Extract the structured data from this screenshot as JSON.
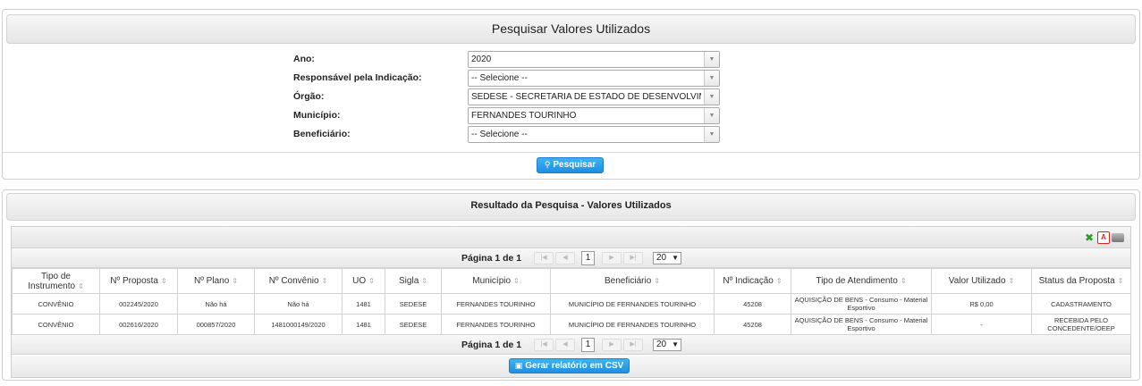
{
  "search": {
    "title": "Pesquisar Valores Utilizados",
    "fields": [
      {
        "label": "Ano:",
        "value": "2020"
      },
      {
        "label": "Responsável pela Indicação:",
        "value": "-- Selecione --"
      },
      {
        "label": "Órgão:",
        "value": "SEDESE - SECRETARIA DE ESTADO DE DESENVOLVIMENTO SOCIAL"
      },
      {
        "label": "Município:",
        "value": "FERNANDES TOURINHO"
      },
      {
        "label": "Beneficiário:",
        "value": "-- Selecione --"
      }
    ],
    "button_label": "Pesquisar"
  },
  "results": {
    "title": "Resultado da Pesquisa - Valores Utilizados",
    "pager_text": "Página 1 de 1",
    "page_input": "1",
    "page_size": "20",
    "columns": [
      "Tipo de Instrumento",
      "Nº Proposta",
      "Nº Plano",
      "Nº Convênio",
      "UO",
      "Sigla",
      "Município",
      "Beneficiário",
      "Nº Indicação",
      "Tipo de Atendimento",
      "Valor Utilizado",
      "Status da Proposta"
    ],
    "rows": [
      [
        "CONVÊNIO",
        "002245/2020",
        "Não há",
        "Não há",
        "1481",
        "SEDESE",
        "FERNANDES TOURINHO",
        "MUNICÍPIO DE FERNANDES TOURINHO",
        "45208",
        "AQUISIÇÃO DE BENS - Consumo - Material Esportivo",
        "R$ 0,00",
        "CADASTRAMENTO"
      ],
      [
        "CONVÊNIO",
        "002616/2020",
        "000857/2020",
        "1481000149/2020",
        "1481",
        "SEDESE",
        "FERNANDES TOURINHO",
        "MUNICÍPIO DE FERNANDES TOURINHO",
        "45208",
        "AQUISIÇÃO DE BENS - Consumo - Material Esportivo",
        "-",
        "RECEBIDA PELO CONCEDENTE/OEEP"
      ]
    ],
    "csv_button_label": "Gerar relatório em CSV"
  },
  "icons": {
    "excel": "excel-export-icon",
    "pdf": "pdf-export-icon",
    "print": "print-icon",
    "search": "magnifier-icon",
    "csv": "csv-icon"
  },
  "colors": {
    "button_blue": "#1f8fe0",
    "excel_green": "#2e9b2e",
    "pdf_red": "#d9261c"
  }
}
